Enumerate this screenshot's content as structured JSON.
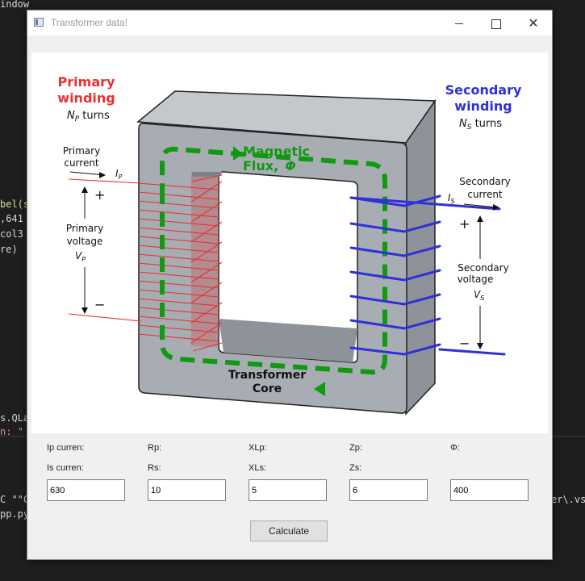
{
  "editor": {
    "lines": [
      "indow",
      "bel(s",
      ",641",
      "col3",
      "re)",
      "s.QLa",
      "n: \"",
      "C \"\"C",
      "pp.py",
      "er\\.vsc"
    ]
  },
  "window": {
    "title": "Transformer data!",
    "minimize_icon": "minimize-icon",
    "maximize_icon": "maximize-icon",
    "close_glyph": "✕"
  },
  "diagram": {
    "primary_title_1": "Primary",
    "primary_title_2": "winding",
    "np": "N",
    "np_sub": "P",
    "np_suffix": " turns",
    "primary_current_1": "Primary",
    "primary_current_2": "current",
    "ip": "I",
    "ip_sub": "P",
    "plus": "+",
    "minus": "−",
    "primary_voltage_1": "Primary",
    "primary_voltage_2": "voltage",
    "vp": "V",
    "vp_sub": "P",
    "secondary_title_1": "Secondary",
    "secondary_title_2": "winding",
    "ns": "N",
    "ns_sub": "S",
    "ns_suffix": " turns",
    "secondary_current_1": "Secondary",
    "secondary_current_2": "current",
    "is": "I",
    "is_sub": "S",
    "secondary_voltage_1": "Secondary",
    "secondary_voltage_2": "voltage",
    "vs": "V",
    "vs_sub": "S",
    "flux_1": "Magnetic",
    "flux_2": "Flux,",
    "phi": "Φ",
    "core_1": "Transformer",
    "core_2": "Core",
    "colors": {
      "primary": "#e63232",
      "secondary": "#3030d8",
      "flux": "#119911",
      "core": "#a8adb4"
    }
  },
  "form": {
    "row1": [
      "Ip curren:",
      "Rp:",
      "XLp:",
      "Zp:",
      "Φ:"
    ],
    "row2": [
      "Is curren:",
      "Rs:",
      "XLs:",
      "Zs:"
    ],
    "inputs": [
      "630",
      "10",
      "5",
      "6",
      "400"
    ],
    "calculate_label": "Calculate"
  }
}
